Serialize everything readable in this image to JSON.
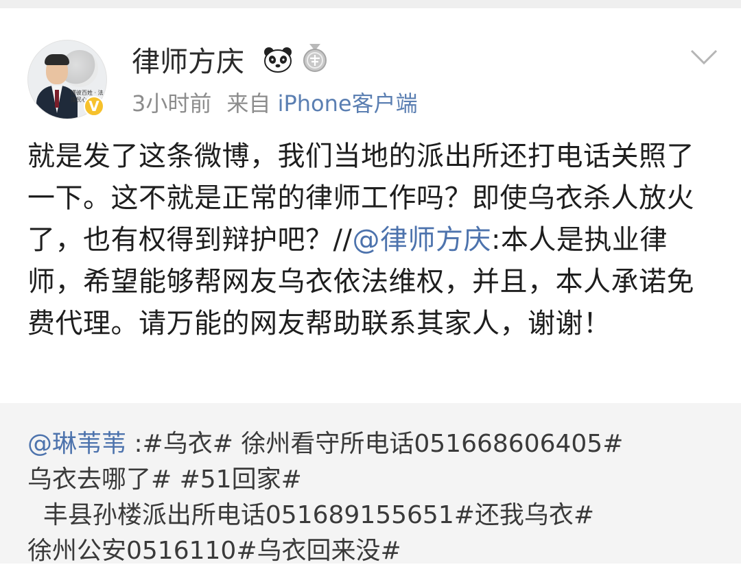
{
  "post": {
    "username": "律师方庆",
    "time": "3小时前",
    "source_prefix": "来自",
    "source": "iPhone客户端",
    "avatar_caption": "懂彼百姓 · 法懂民心",
    "verified_mark": "V",
    "badges": [
      "panda-badge",
      "medal-badge"
    ],
    "text_before_mention": "就是发了这条微博，我们当地的派出所还打电话关照了一下。这不就是正常的律师工作吗？即使乌衣杀人放火了，也有权得到辩护吧？//",
    "mention": "@律师方庆",
    "text_after_mention": ":本人是执业律师，希望能够帮网友乌衣依法维权，并且，本人承诺免费代理。请万能的网友帮助联系其家人，谢谢！"
  },
  "repost": {
    "mention": "@琳苇苇",
    "line1_rest": " :#乌衣#  徐州看守所电话051668606405#",
    "line2": "乌衣去哪了#  #51回家#",
    "line3": "  丰县孙楼派出所电话051689155651#还我乌衣#",
    "line4": "徐州公安0516110#乌衣回来没#"
  },
  "colors": {
    "link": "#4d73ad",
    "meta": "#8c8c8c",
    "repost_bg": "#f4f4f4",
    "verified": "#f6c12c"
  }
}
